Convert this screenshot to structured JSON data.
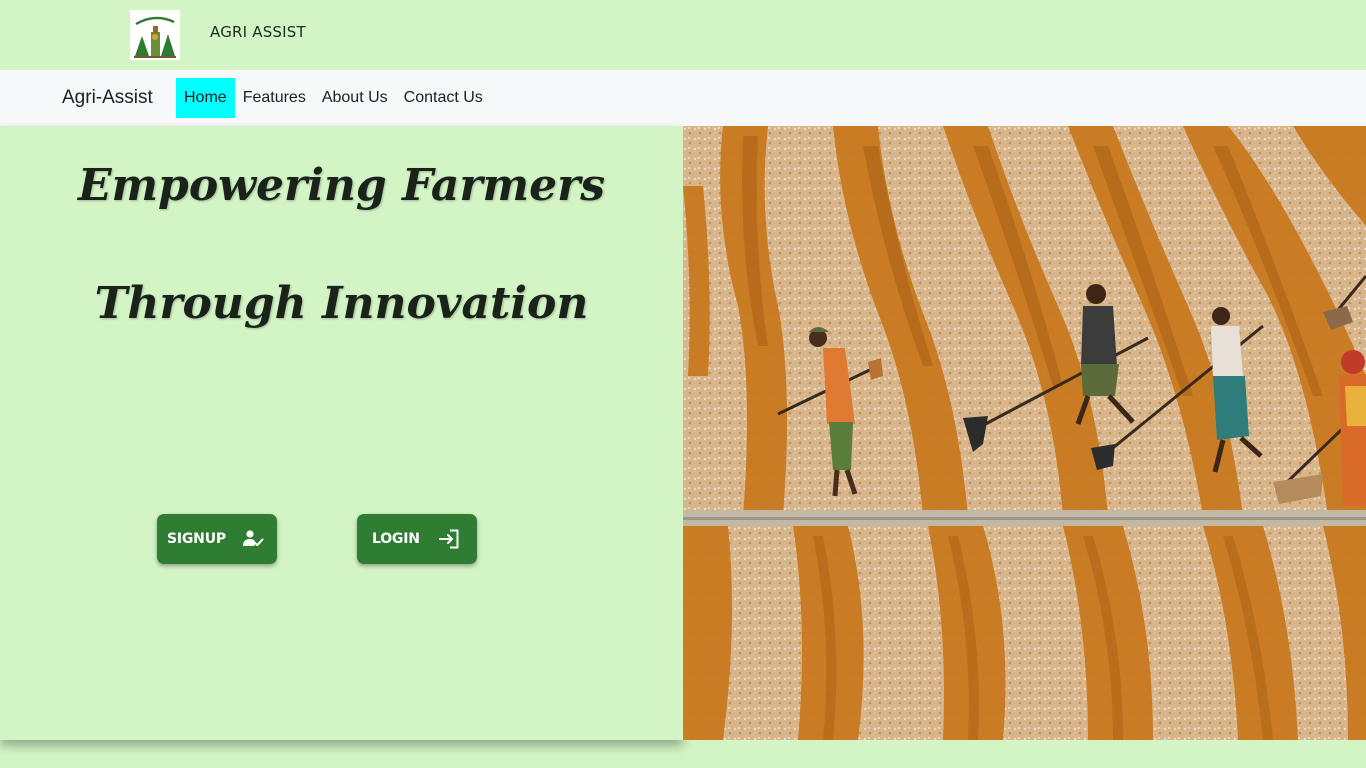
{
  "header": {
    "logo_text": "Agri Assist",
    "title": "AGRI ASSIST"
  },
  "navbar": {
    "brand": "Agri-Assist",
    "links": [
      {
        "label": "Home",
        "active": true
      },
      {
        "label": "Features",
        "active": false
      },
      {
        "label": "About Us",
        "active": false
      },
      {
        "label": "Contact Us",
        "active": false
      }
    ]
  },
  "hero": {
    "headline_line1": "Empowering Farmers",
    "headline_line2": "Through Innovation",
    "signup_label": "SIGNUP",
    "signup_icon": "user-check-icon",
    "login_label": "LOGIN",
    "login_icon": "login-icon",
    "image_subject": "farmers raking grain drying in rows"
  },
  "colors": {
    "page_background": "#d3f5c6",
    "navbar_background": "#f7f8fa",
    "active_nav": "#00ffff",
    "button": "#2e7d32",
    "grain": "#c07a2a"
  }
}
